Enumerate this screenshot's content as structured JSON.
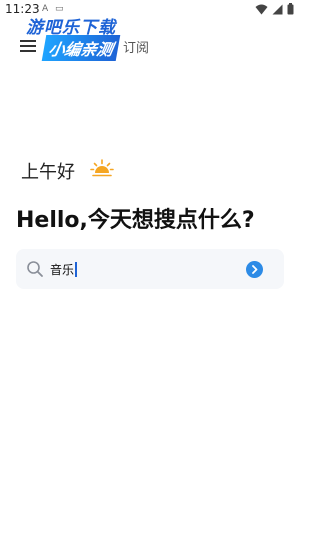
{
  "status_bar": {
    "time": "11:23",
    "indicator_1": "A",
    "indicator_2": "▭"
  },
  "watermark": {
    "line1": "游吧乐下载",
    "line2": "小编亲测"
  },
  "top_bar": {
    "subscribe_label": "订阅"
  },
  "greeting": {
    "text": "上午好",
    "icon": "sunrise-icon",
    "icon_color": "#f5a623"
  },
  "headline": "Hello,今天想搜点什么?",
  "search": {
    "value": "音乐",
    "search_icon": "search-icon",
    "go_icon": "arrow-right-circle-icon",
    "accent": "#2d8be6"
  }
}
